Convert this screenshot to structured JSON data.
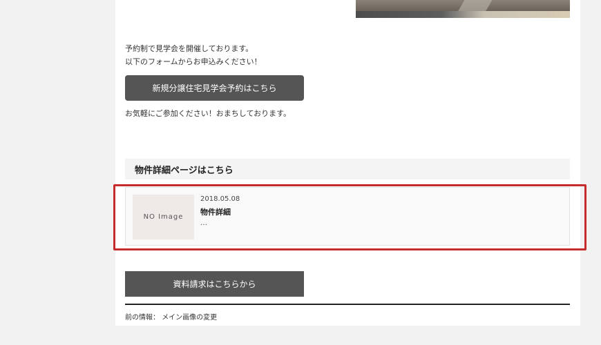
{
  "intro": {
    "line1": "予約制で見学会を開催しております。",
    "line2": "以下のフォームからお申込みください！"
  },
  "buttons": {
    "reservation": "新規分譲住宅見学会予約はこちら",
    "brochure": "資料請求はこちらから"
  },
  "welcome_text": "お気軽にご参加ください！おまちしております。",
  "section": {
    "heading": "物件詳細ページはこちら"
  },
  "property_card": {
    "thumbnail_text": "NO Image",
    "date": "2018.05.08",
    "title": "物件詳細",
    "excerpt": "…"
  },
  "pagination": {
    "prev_label": "前の情報：",
    "prev_link": "メイン画像の変更"
  },
  "colors": {
    "highlight_border": "#c62a2a",
    "button_bg": "#555555"
  }
}
